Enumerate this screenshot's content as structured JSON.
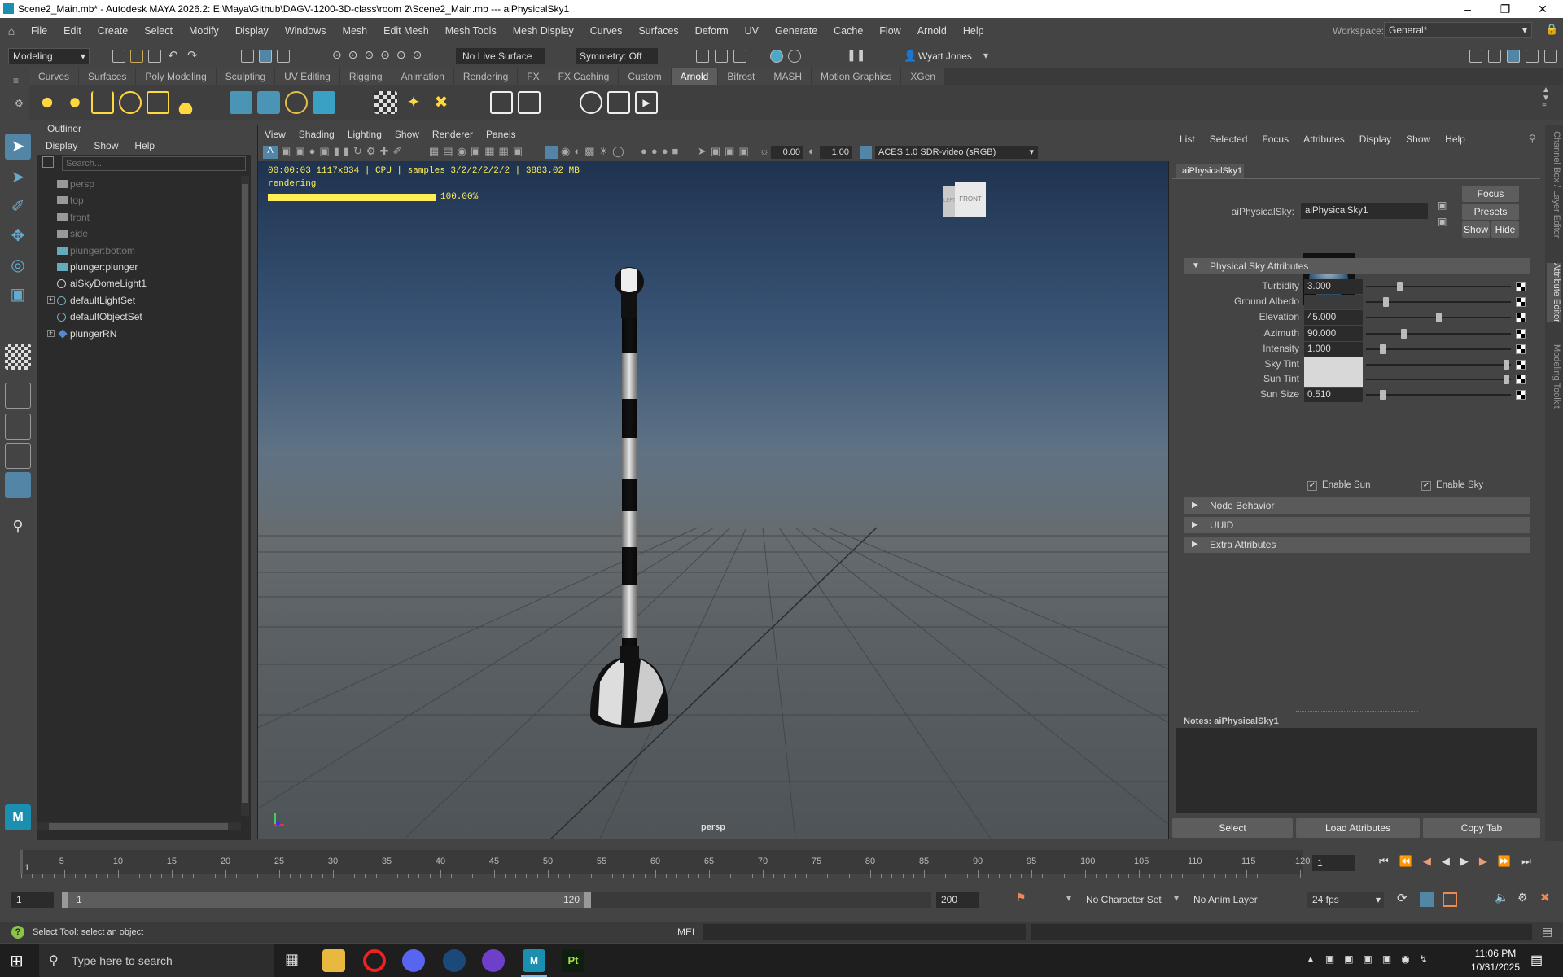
{
  "window": {
    "title": "Scene2_Main.mb* - Autodesk MAYA 2026.2: E:\\Maya\\Github\\DAGV-1200-3D-class\\room 2\\Scene2_Main.mb   ---   aiPhysicalSky1"
  },
  "menubar": {
    "items": [
      "File",
      "Edit",
      "Create",
      "Select",
      "Modify",
      "Display",
      "Windows",
      "Mesh",
      "Edit Mesh",
      "Mesh Tools",
      "Mesh Display",
      "Curves",
      "Surfaces",
      "Deform",
      "UV",
      "Generate",
      "Cache",
      "Flow",
      "Arnold",
      "Help"
    ],
    "workspace_label": "Workspace:",
    "workspace_value": "General*"
  },
  "statusline": {
    "mode": "Modeling",
    "live_surface": "No Live Surface",
    "symmetry": "Symmetry: Off",
    "user": "Wyatt Jones"
  },
  "shelf": {
    "tabs": [
      "Curves",
      "Surfaces",
      "Poly Modeling",
      "Sculpting",
      "UV Editing",
      "Rigging",
      "Animation",
      "Rendering",
      "FX",
      "FX Caching",
      "Custom",
      "Arnold",
      "Bifrost",
      "MASH",
      "Motion Graphics",
      "XGen"
    ],
    "active_tab": "Arnold"
  },
  "outliner": {
    "title": "Outliner",
    "menu": [
      "Display",
      "Show",
      "Help"
    ],
    "search_placeholder": "Search...",
    "items": [
      {
        "name": "persp",
        "dim": true,
        "icon": "camera-icon"
      },
      {
        "name": "top",
        "dim": true,
        "icon": "camera-icon"
      },
      {
        "name": "front",
        "dim": true,
        "icon": "camera-icon"
      },
      {
        "name": "side",
        "dim": true,
        "icon": "camera-icon"
      },
      {
        "name": "plunger:bottom",
        "dim": true,
        "icon": "mesh-icon"
      },
      {
        "name": "plunger:plunger",
        "dim": false,
        "icon": "mesh-icon"
      },
      {
        "name": "aiSkyDomeLight1",
        "dim": false,
        "icon": "light-icon"
      },
      {
        "name": "defaultLightSet",
        "dim": false,
        "icon": "set-icon"
      },
      {
        "name": "defaultObjectSet",
        "dim": false,
        "icon": "set-icon"
      },
      {
        "name": "plungerRN",
        "dim": false,
        "icon": "reference-icon"
      }
    ]
  },
  "viewport": {
    "menu": [
      "View",
      "Shading",
      "Lighting",
      "Show",
      "Renderer",
      "Panels"
    ],
    "field_value_1": "0.00",
    "field_value_2": "1.00",
    "color_space": "ACES 1.0 SDR-video (sRGB)",
    "hud_line": "00:00:03 1117x834 | CPU | samples 3/2/2/2/2/2 | 3883.02 MB",
    "hud_status": "rendering",
    "progress_percent_label": "100.00%",
    "progress": 1.0,
    "camera_label": "persp",
    "viewcube_front": "FRONT",
    "viewcube_left": "LEFT"
  },
  "attribute_editor": {
    "menu": [
      "List",
      "Selected",
      "Focus",
      "Attributes",
      "Display",
      "Show",
      "Help"
    ],
    "tab": "aiPhysicalSky1",
    "node_type_label": "aiPhysicalSky:",
    "node_name": "aiPhysicalSky1",
    "buttons": {
      "focus": "Focus",
      "presets": "Presets",
      "show": "Show",
      "hide": "Hide"
    },
    "section_title": "Physical Sky Attributes",
    "attributes": [
      {
        "label": "Turbidity",
        "value": "3.000",
        "slider": 0.22
      },
      {
        "label": "Ground Albedo",
        "value": "",
        "slider": 0.12
      },
      {
        "label": "Elevation",
        "value": "45.000",
        "slider": 0.5
      },
      {
        "label": "Azimuth",
        "value": "90.000",
        "slider": 0.25
      },
      {
        "label": "Intensity",
        "value": "1.000",
        "slider": 0.1
      },
      {
        "label": "Sky Tint",
        "value": "",
        "slider": 0.98
      },
      {
        "label": "Sun Tint",
        "value": "",
        "slider": 0.98
      },
      {
        "label": "Sun Size",
        "value": "0.510",
        "slider": 0.1
      }
    ],
    "enable_sun": "Enable Sun",
    "enable_sky": "Enable Sky",
    "collapsed_sections": [
      "Node Behavior",
      "UUID",
      "Extra Attributes"
    ],
    "notes_label": "Notes:  aiPhysicalSky1",
    "bottom_buttons": [
      "Select",
      "Load Attributes",
      "Copy Tab"
    ]
  },
  "side_tabs": [
    "Channel Box / Layer Editor",
    "Attribute Editor",
    "Modeling Toolkit"
  ],
  "timeslider": {
    "ticks": [
      "5",
      "10",
      "15",
      "20",
      "25",
      "30",
      "35",
      "40",
      "45",
      "50",
      "55",
      "60",
      "65",
      "70",
      "75",
      "80",
      "85",
      "90",
      "95",
      "100",
      "105",
      "110",
      "115",
      "120"
    ],
    "current_frame_marker": "1",
    "current_frame_field": "1"
  },
  "range": {
    "start": "1",
    "inner_start": "1",
    "inner_end": "120",
    "end": "200",
    "character_set": "No Character Set",
    "anim_layer": "No Anim Layer",
    "fps": "24 fps"
  },
  "commandline": {
    "help_text": "Select Tool: select an object",
    "mel_label": "MEL"
  },
  "taskbar": {
    "search_placeholder": "Type here to search",
    "time": "11:06 PM",
    "date": "10/31/2025"
  },
  "colors": {
    "accent_blue": "#5285a6",
    "progress_yellow": "#ffee55",
    "active_tab": "#5d5d5d"
  }
}
